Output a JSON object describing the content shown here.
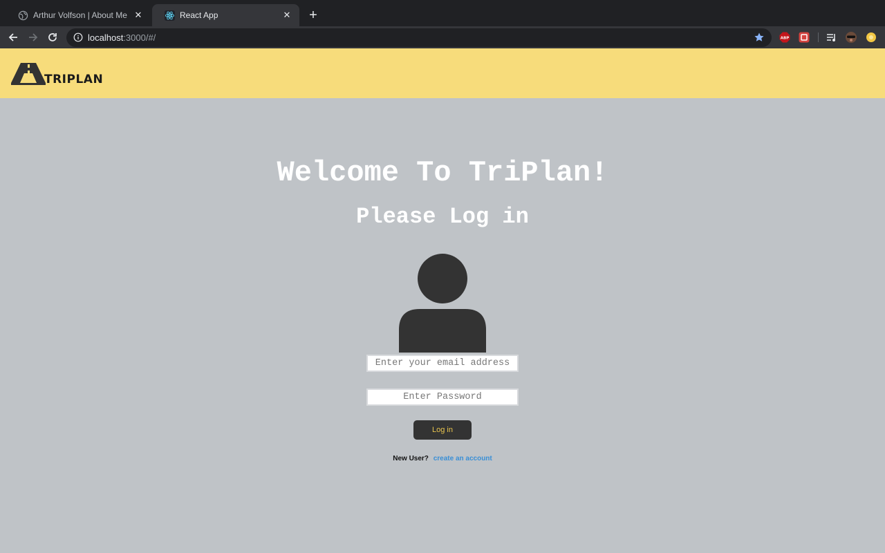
{
  "browser": {
    "tabs": [
      {
        "title": "Arthur Volfson | About Me",
        "active": false,
        "favicon": "globe-icon"
      },
      {
        "title": "React App",
        "active": true,
        "favicon": "react-icon"
      }
    ],
    "url": {
      "host": "localhost",
      "rest": ":3000/#/"
    },
    "extensions": [
      {
        "name": "adblock-icon",
        "label": "ABP"
      },
      {
        "name": "extension-red-icon",
        "label": ""
      },
      {
        "name": "media-control-icon",
        "label": ""
      },
      {
        "name": "profile-avatar-icon",
        "label": ""
      },
      {
        "name": "extension-yellow-icon",
        "label": ""
      }
    ]
  },
  "app": {
    "logo_text": "TRIPLAN",
    "welcome": "Welcome To TriPlan!",
    "subtitle": "Please Log in",
    "email_placeholder": "Enter your email address",
    "password_placeholder": "Enter Password",
    "login_label": "Log in",
    "new_user": "New User?",
    "create_account": "create an account"
  },
  "colors": {
    "header": "#f7dc7b",
    "background": "#bfc3c7",
    "button_bg": "#333333",
    "button_text": "#e8c44e",
    "link": "#3a8fd6"
  }
}
